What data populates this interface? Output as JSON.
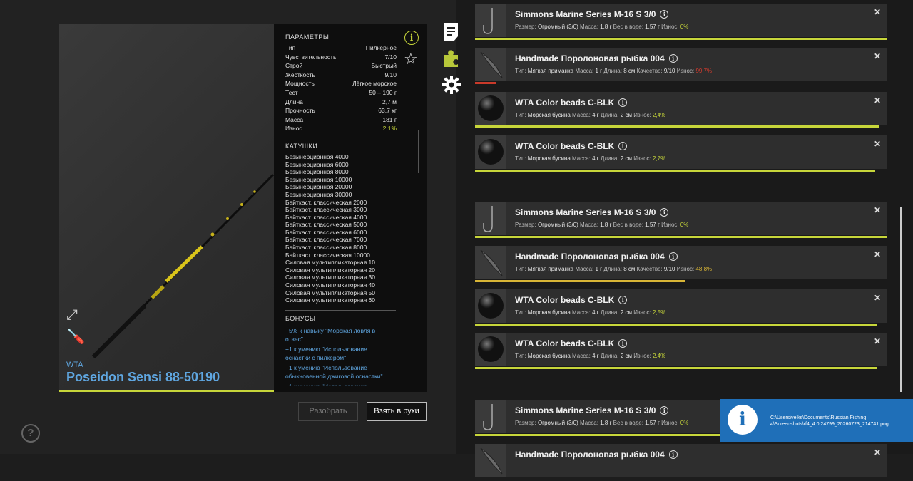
{
  "rod": {
    "brand": "WTA",
    "name": "Poseidon Sensi 88-50190",
    "params_title": "ПАРАМЕТРЫ",
    "params": [
      {
        "label": "Тип",
        "value": "Пилкерное"
      },
      {
        "label": "Чувствительность",
        "value": "7/10"
      },
      {
        "label": "Строй",
        "value": "Быстрый"
      },
      {
        "label": "Жёсткость",
        "value": "9/10"
      },
      {
        "label": "Мощность",
        "value": "Лёгкое морское"
      },
      {
        "label": "Тест",
        "value": "50 – 190 г"
      },
      {
        "label": "Длина",
        "value": "2,7 м"
      },
      {
        "label": "Прочность",
        "value": "63,7 кг"
      },
      {
        "label": "Масса",
        "value": "181 г"
      },
      {
        "label": "Износ",
        "value": "2,1%"
      }
    ],
    "reels_title": "КАТУШКИ",
    "reels": [
      "Безынерционная 4000",
      "Безынерционная 6000",
      "Безынерционная 8000",
      "Безынерционная 10000",
      "Безынерционная 20000",
      "Безынерционная 30000",
      "Байткаст. классическая 2000",
      "Байткаст. классическая 3000",
      "Байткаст. классическая 4000",
      "Байткаст. классическая 5000",
      "Байткаст. классическая 6000",
      "Байткаст. классическая 7000",
      "Байткаст. классическая 8000",
      "Байткаст. классическая 10000",
      "Силовая мультипликаторная 10",
      "Силовая мультипликаторная 20",
      "Силовая мультипликаторная 30",
      "Силовая мультипликаторная 40",
      "Силовая мультипликаторная 50",
      "Силовая мультипликаторная 60"
    ],
    "bonuses_title": "БОНУСЫ",
    "bonuses": [
      "+5% к навыку \"Морская ловля в отвес\"",
      "+1 к умению \"Использование оснастки с пилкером\"",
      "+1 к умению \"Использование обыкновенной джиговой оснастки\"",
      "+1 к умению \"Использование"
    ],
    "wear_progress": 0.98
  },
  "buttons": {
    "disassemble": "Разобрать",
    "take": "Взять в руки"
  },
  "icons": {
    "info": "i",
    "star": "☆",
    "help": "?",
    "close": "✕"
  },
  "tackle": [
    {
      "title": "Simmons Marine Series M-16 S 3/0",
      "meta": [
        [
          "Размер:",
          "Огромный (3/0)"
        ],
        [
          "Масса:",
          "1,8 г"
        ],
        [
          "Вес в воде:",
          "1,57 г"
        ],
        [
          "Износ:",
          "0%"
        ]
      ],
      "wear_class": "good",
      "bar": 0.998,
      "bar_color": "green",
      "icon": "hook"
    },
    {
      "title": "Handmade Поролоновая рыбка 004",
      "meta": [
        [
          "Тип:",
          "Мягкая приманка"
        ],
        [
          "Масса:",
          "1 г"
        ],
        [
          "Длина:",
          "8 см"
        ],
        [
          "Качество:",
          "9/10"
        ],
        [
          "Износ:",
          "99,7%"
        ]
      ],
      "wear_class": "bad",
      "bar": 0.05,
      "bar_color": "red",
      "icon": "fish"
    },
    {
      "title": "WTA Color beads C-BLK",
      "meta": [
        [
          "Тип:",
          "Морская бусина"
        ],
        [
          "Масса:",
          "4 г"
        ],
        [
          "Длина:",
          "2 см"
        ],
        [
          "Износ:",
          "2,4%"
        ]
      ],
      "wear_class": "good",
      "bar": 0.98,
      "bar_color": "green",
      "icon": "bead"
    },
    {
      "title": "WTA Color beads C-BLK",
      "meta": [
        [
          "Тип:",
          "Морская бусина"
        ],
        [
          "Масса:",
          "4 г"
        ],
        [
          "Длина:",
          "2 см"
        ],
        [
          "Износ:",
          "2,7%"
        ]
      ],
      "wear_class": "good",
      "bar": 0.97,
      "bar_color": "green",
      "icon": "bead"
    },
    {
      "title": "Simmons Marine Series M-16 S 3/0",
      "meta": [
        [
          "Размер:",
          "Огромный (3/0)"
        ],
        [
          "Масса:",
          "1,8 г"
        ],
        [
          "Вес в воде:",
          "1,57 г"
        ],
        [
          "Износ:",
          "0%"
        ]
      ],
      "wear_class": "good",
      "bar": 0.998,
      "bar_color": "green",
      "icon": "hook"
    },
    {
      "title": "Handmade Поролоновая рыбка 004",
      "meta": [
        [
          "Тип:",
          "Мягкая приманка"
        ],
        [
          "Масса:",
          "1 г"
        ],
        [
          "Длина:",
          "8 см"
        ],
        [
          "Качество:",
          "9/10"
        ],
        [
          "Износ:",
          "48,8%"
        ]
      ],
      "wear_class": "warn",
      "bar": 0.51,
      "bar_color": "yellow",
      "icon": "fish"
    },
    {
      "title": "WTA Color beads C-BLK",
      "meta": [
        [
          "Тип:",
          "Морская бусина"
        ],
        [
          "Масса:",
          "4 г"
        ],
        [
          "Длина:",
          "2 см"
        ],
        [
          "Износ:",
          "2,5%"
        ]
      ],
      "wear_class": "good",
      "bar": 0.975,
      "bar_color": "green",
      "icon": "bead"
    },
    {
      "title": "WTA Color beads C-BLK",
      "meta": [
        [
          "Тип:",
          "Морская бусина"
        ],
        [
          "Масса:",
          "4 г"
        ],
        [
          "Длина:",
          "2 см"
        ],
        [
          "Износ:",
          "2,4%"
        ]
      ],
      "wear_class": "good",
      "bar": 0.976,
      "bar_color": "green",
      "icon": "bead"
    },
    {
      "title": "Simmons Marine Series M-16 S 3/0",
      "meta": [
        [
          "Размер:",
          "Огромный (3/0)"
        ],
        [
          "Масса:",
          "1,8 г"
        ],
        [
          "Вес в воде:",
          "1,57 г"
        ],
        [
          "Износ:",
          "0%"
        ]
      ],
      "wear_class": "good",
      "bar": 0.998,
      "bar_color": "green",
      "icon": "hook"
    },
    {
      "title": "Handmade Поролоновая рыбка 004",
      "meta": [],
      "wear_class": "good",
      "bar": 0,
      "bar_color": "green",
      "icon": "fish"
    }
  ],
  "toast": {
    "path_line1": "C:\\Users\\velks\\Documents\\Russian Fishing",
    "path_line2": "4\\Screenshots\\rf4_4.0.24799_20260723_214741.png"
  },
  "colors": {
    "accent": "#c7d63a",
    "link": "#5fa6e0",
    "danger": "#c93a2a",
    "warn": "#d8b536",
    "toast": "#1f6fb8"
  }
}
